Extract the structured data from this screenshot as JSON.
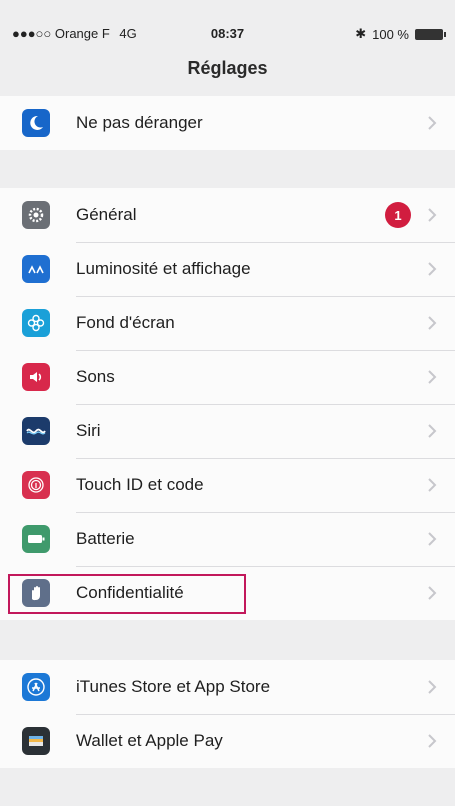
{
  "status_bar": {
    "carrier": "●●●○○ Orange F",
    "network": "4G",
    "time": "08:37",
    "battery_text": "100 %"
  },
  "nav": {
    "title": "Réglages"
  },
  "groups": [
    {
      "items": [
        {
          "label": "Ne pas déranger",
          "icon": "moon-icon",
          "color": "#1766c9"
        }
      ]
    },
    {
      "items": [
        {
          "label": "Général",
          "icon": "gear-icon",
          "color": "#6b6f75",
          "badge": "1"
        },
        {
          "label": "Luminosité et affichage",
          "icon": "brightness-icon",
          "color": "#1f6fd1"
        },
        {
          "label": "Fond d'écran",
          "icon": "flower-icon",
          "color": "#1aa0d8"
        },
        {
          "label": "Sons",
          "icon": "speaker-icon",
          "color": "#d8284b"
        },
        {
          "label": "Siri",
          "icon": "siri-icon",
          "color": "#1c3b6b"
        },
        {
          "label": "Touch ID et code",
          "icon": "fingerprint-icon",
          "color": "#d8304f"
        },
        {
          "label": "Batterie",
          "icon": "battery-icon",
          "color": "#3f9a6c"
        },
        {
          "label": "Confidentialité",
          "icon": "hand-icon",
          "color": "#5f6f8a",
          "highlighted": true
        }
      ]
    },
    {
      "items": [
        {
          "label": "iTunes Store et App Store",
          "icon": "app-store-icon",
          "color": "#1c78d6"
        },
        {
          "label": "Wallet et Apple Pay",
          "icon": "wallet-icon",
          "color": "#2b3136"
        }
      ]
    }
  ],
  "colors": {
    "chevron": "#c7c7cc",
    "highlight": "#c2185b"
  }
}
